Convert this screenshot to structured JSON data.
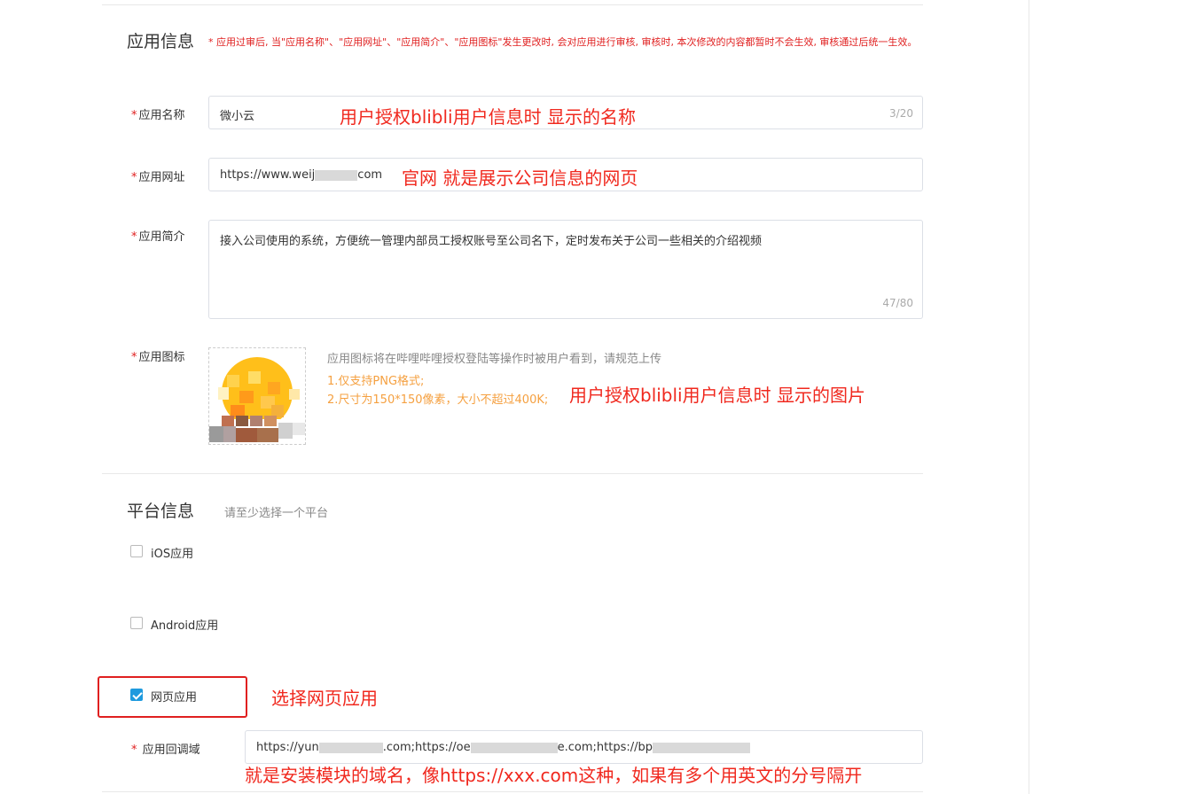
{
  "app_info": {
    "title": "应用信息",
    "notice": "* 应用过审后, 当\"应用名称\"、\"应用网址\"、\"应用简介\"、\"应用图标\"发生更改时, 会对应用进行审核, 审核时, 本次修改的内容都暂时不会生效, 审核通过后统一生效。",
    "name": {
      "label": "应用名称",
      "value": "微小云",
      "count": "3/20"
    },
    "url": {
      "label": "应用网址",
      "value_prefix": "https://www.weij",
      "value_suffix": "com"
    },
    "intro": {
      "label": "应用简介",
      "value": "接入公司使用的系统，方便统一管理内部员工授权账号至公司名下，定时发布关于公司一些相关的介绍视频",
      "count": "47/80"
    },
    "icon": {
      "label": "应用图标",
      "hint": "应用图标将在哔哩哔哩授权登陆等操作时被用户看到，请规范上传",
      "rule1": "1.仅支持PNG格式;",
      "rule2": "2.尺寸为150*150像素，大小不超过400K;"
    }
  },
  "platform": {
    "title": "平台信息",
    "hint": "请至少选择一个平台",
    "ios": {
      "label": "iOS应用",
      "checked": false
    },
    "android": {
      "label": "Android应用",
      "checked": false
    },
    "web": {
      "label": "网页应用",
      "checked": true
    },
    "callback": {
      "label": "应用回调域",
      "value_part1": "https://yun",
      "value_part2": ".com;https://oe",
      "value_part3": "e.com;https://bp"
    }
  },
  "annotations": {
    "name_note": "用户授权blibli用户信息时 显示的名称",
    "url_note": "官网 就是展示公司信息的网页",
    "icon_note": "用户授权blibli用户信息时 显示的图片",
    "web_note": "选择网页应用",
    "callback_note": "就是安装模块的域名，像https://xxx.com这种，如果有多个用英文的分号隔开"
  },
  "colors": {
    "required": "#e02020",
    "annotation": "#f0281e",
    "checkbox_checked": "#1e9ade",
    "rule_text": "#f5a040"
  }
}
